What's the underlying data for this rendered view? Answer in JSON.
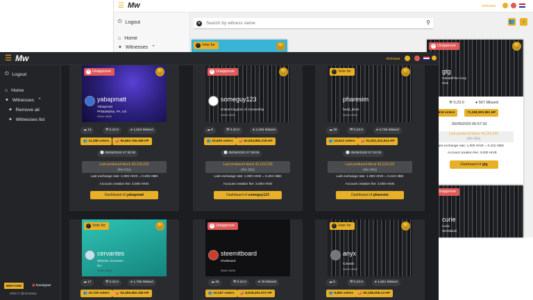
{
  "colors": {
    "accent": "#e8b026",
    "unapprove": "#e05a5a",
    "vote": "#e8b026",
    "dark_bg": "#1c1d20",
    "card_bg": "#2a2b2f"
  },
  "bg_app": {
    "logo": "Mw",
    "user": "mintrawa",
    "search_placeholder": "Search by witness name",
    "sidebar": {
      "logout": "Logout",
      "home": "Home",
      "witnesses": "Witnesses"
    },
    "top_card_pill": "Vote for",
    "gtg": {
      "pill": "Unapprove",
      "name": "gtg",
      "owner": "Gandalf the Grey",
      "location": "Hive",
      "comments": "1",
      "version": "0.23.0",
      "missed": "567 Missed",
      "voters": "14,619 voters",
      "hp": "71,258,900.881 HP",
      "date": "05/05/2020 06:57:33",
      "last_block_label": "Last produced block",
      "last_block": "43,124,226",
      "last_block_ago": "(4m 42s)",
      "exchange": "Last exchange rate: 1.000 HIVE = 0.412 HBD",
      "fee": "Account creation fee: 3.000 HIVE",
      "dashboard_prefix": "Dashboard of",
      "dashboard_name": "gtg"
    },
    "curie": {
      "pill": "Unapprove",
      "name": "curie",
      "owner": "Curie",
      "location": "Worldwide"
    }
  },
  "dark_app": {
    "logo": "Mw",
    "user": "mintrawa",
    "sidebar": {
      "logout": "Logout",
      "home": "Home",
      "witnesses": "Witnesses",
      "remove_all": "Remove all",
      "witnesses_list": "Witnesses list"
    },
    "footer": {
      "brand1": "BEEYOND",
      "brand2": "hivesigner",
      "copyright": "2020 © @mintrawa"
    },
    "cards": [
      {
        "pill": "Unapprove",
        "pill_type": "unapprove",
        "name": "yabapmatt",
        "owner": "Yabapmatt",
        "location": "Philadelphia, PA, US",
        "www": "www www",
        "comments": "13",
        "version": "0.23.0",
        "missed": "1,603 Missed",
        "voters": "11,298 voters",
        "hp": "55,860,768.488 HP",
        "date": "05/05/2020 07:30:30",
        "last_block_label": "Last produced block",
        "last_block": "43,124,223",
        "last_block_ago": "(4m 51s)",
        "exchange": "Last exchange rate: 1.000 HIVE = 0.409 HBD",
        "fee": "Account creation fee: 3.000 HIVE",
        "dashboard_prefix": "Dashboard of",
        "dashboard_name": "yabapmatt"
      },
      {
        "pill": "Unapprove",
        "pill_type": "unapprove",
        "name": "someguy123",
        "owner": "",
        "location": "United Kingdom of Censorship",
        "www": "www www",
        "comments": "9",
        "version": "0.23.0",
        "missed": "2,205 Missed",
        "voters": "10,836 voters",
        "hp": "62,834,882.218 HP",
        "date": "05/05/2020 07:38:06",
        "last_block_label": "Last produced block",
        "last_block": "43,124,230",
        "last_block_ago": "(4m 30s)",
        "exchange": "Last exchange rate: 1.000 HIVE = 0.404 HBD",
        "fee": "Account creation fee: 3.000 HIVE",
        "dashboard_prefix": "Dashboard of",
        "dashboard_name": "someguy123"
      },
      {
        "pill": "Vote for",
        "pill_type": "vote",
        "name": "pharesim",
        "owner": "",
        "location": "head_block",
        "www": "www www",
        "comments": "29",
        "version": "0.23.0",
        "missed": "3,736 Missed",
        "voters": "10,612 voters",
        "hp": "51,522,412.613 HP",
        "date": "05/05/2020 07:23:03",
        "last_block_label": "Last produced block",
        "last_block": "43,124,222",
        "last_block_ago": "(4m 54s)",
        "exchange": "Last exchange rate: 1.000 HIVE = 0.410 HBD",
        "fee": "Account creation fee: 3.000 HIVE",
        "dashboard_prefix": "Dashboard of",
        "dashboard_name": "pharesim"
      },
      {
        "pill": "Vote for",
        "pill_type": "vote",
        "name": "cervantes",
        "owner": "Witness cervantes",
        "location": "EU",
        "www": "www www",
        "comments": "17",
        "version": "0.23.0",
        "missed": "1,796 Missed",
        "voters": "10,738 voters",
        "hp": "52,459,682.286 HP"
      },
      {
        "pill": "Unapprove",
        "pill_type": "unapprove",
        "name": "steemitboard",
        "owner": "HiveBoard",
        "location": "",
        "www": "www www",
        "comments": "49",
        "version": "0.23.0",
        "missed": "78 Missed",
        "voters": "10,167 voters",
        "hp": "8,618,291.572 HP"
      },
      {
        "pill": "Vote for",
        "pill_type": "vote",
        "name": "anyx",
        "owner": "",
        "location": "Canada",
        "www": "www www",
        "comments": "6",
        "version": "0.23.0",
        "missed": "1,661 Missed",
        "voters": "9,852 voters",
        "hp": "60,188,008.14 HP"
      }
    ]
  }
}
